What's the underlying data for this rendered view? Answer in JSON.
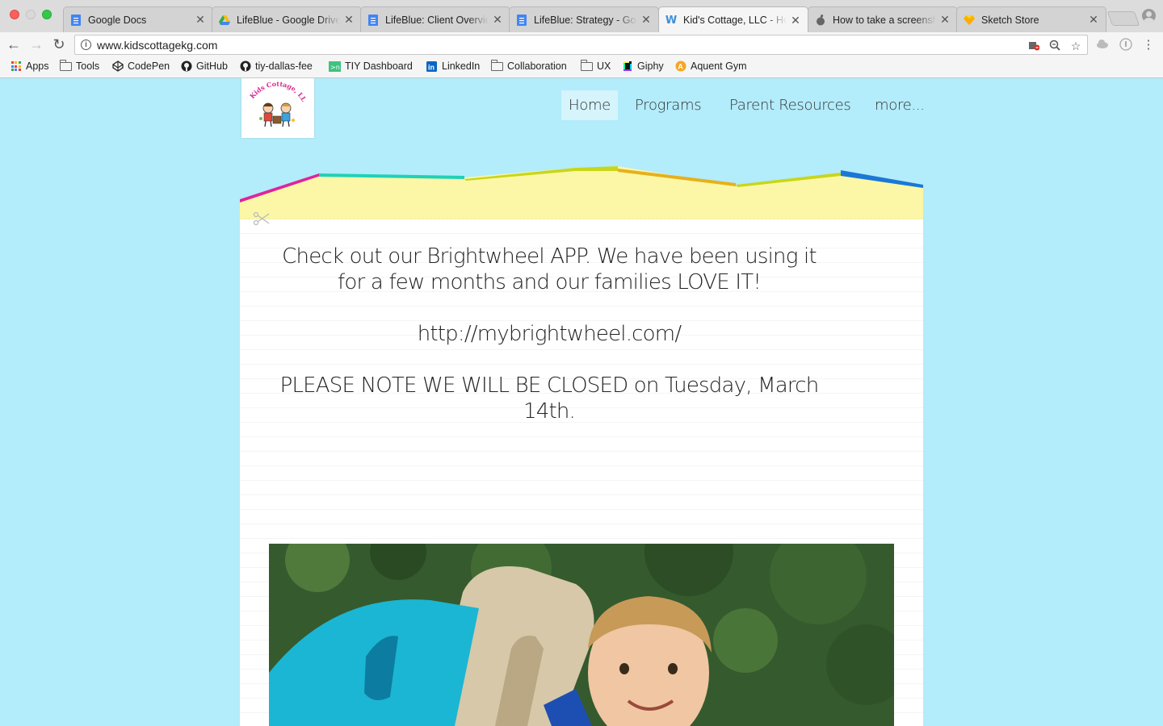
{
  "browser": {
    "tabs": [
      {
        "title": "Google Docs",
        "icon": "docs-icon",
        "active": false
      },
      {
        "title": "LifeBlue - Google Drive",
        "icon": "drive-icon",
        "active": false
      },
      {
        "title": "LifeBlue: Client Overview",
        "icon": "docs-icon",
        "active": false
      },
      {
        "title": "LifeBlue: Strategy - Google Docs",
        "icon": "docs-icon",
        "active": false
      },
      {
        "title": "Kid's Cottage, LLC - Home",
        "icon": "weebly-icon",
        "active": true
      },
      {
        "title": "How to take a screenshot",
        "icon": "apple-icon",
        "active": false
      },
      {
        "title": "Sketch Store",
        "icon": "sketch-icon",
        "active": false
      }
    ],
    "url": "www.kidscottagekg.com",
    "bookmarks": [
      {
        "label": "Apps",
        "icon": "apps-grid-icon"
      },
      {
        "label": "Tools",
        "icon": "folder-icon"
      },
      {
        "label": "CodePen",
        "icon": "codepen-icon"
      },
      {
        "label": "GitHub",
        "icon": "github-icon"
      },
      {
        "label": "tiy-dallas-fee",
        "icon": "github-icon"
      },
      {
        "label": "TIY Dashboard",
        "icon": "tiy-icon"
      },
      {
        "label": "LinkedIn",
        "icon": "linkedin-icon"
      },
      {
        "label": "Collaboration",
        "icon": "folder-icon"
      },
      {
        "label": "UX",
        "icon": "folder-icon"
      },
      {
        "label": "Giphy",
        "icon": "giphy-icon"
      },
      {
        "label": "Aquent Gym",
        "icon": "aquent-icon"
      }
    ]
  },
  "site": {
    "logo_text": "Kids Cottage, LLC",
    "nav": [
      {
        "label": "Home",
        "active": true
      },
      {
        "label": "Programs",
        "active": false
      },
      {
        "label": "Parent Resources",
        "active": false
      },
      {
        "label": "more...",
        "active": false
      }
    ],
    "announcement": {
      "line1": "Check out our Brightwheel APP.  We have been using it",
      "line2": "for a few months and our families LOVE IT!",
      "link": "http://mybrightwheel.com/",
      "notice_line1": "PLEASE NOTE WE WILL BE CLOSED on Tuesday, March",
      "notice_line2": "14th."
    }
  },
  "colors": {
    "page_bg": "#b3ecfa",
    "stripe_magenta": "#e0239b",
    "stripe_teal": "#1fd1b7",
    "stripe_lime": "#c8d61a",
    "stripe_orange": "#e6b01c",
    "stripe_blue": "#1a78d6",
    "band_yellow": "#fbf7a6"
  }
}
